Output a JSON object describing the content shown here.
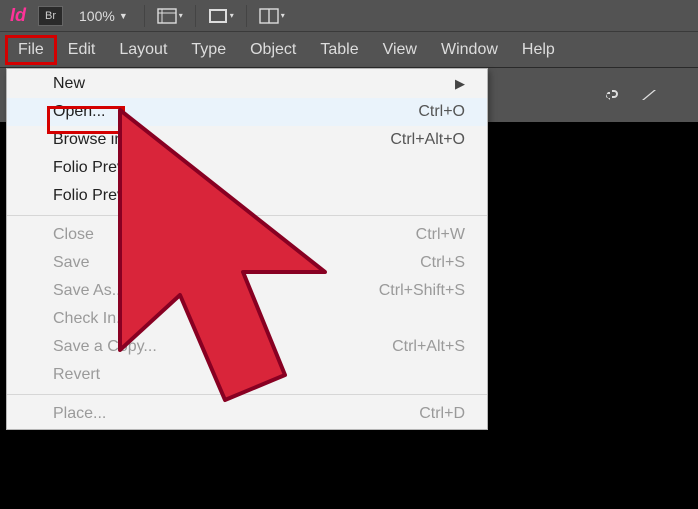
{
  "app": {
    "logo": "Id",
    "bridge": "Br",
    "zoom": "100%"
  },
  "menubar": [
    "File",
    "Edit",
    "Layout",
    "Type",
    "Object",
    "Table",
    "View",
    "Window",
    "Help"
  ],
  "dropdown": {
    "group1": [
      {
        "label": "New",
        "shortcut": "",
        "submenu": true
      },
      {
        "label": "Open...",
        "shortcut": "Ctrl+O",
        "hover": true
      },
      {
        "label": "Browse in",
        "shortcut": "Ctrl+Alt+O"
      },
      {
        "label": "Folio Previ",
        "shortcut": ""
      },
      {
        "label": "Folio Preview S",
        "shortcut": ""
      }
    ],
    "group2": [
      {
        "label": "Close",
        "shortcut": "Ctrl+W",
        "disabled": true
      },
      {
        "label": "Save",
        "shortcut": "Ctrl+S",
        "disabled": true
      },
      {
        "label": "Save As...",
        "shortcut": "Ctrl+Shift+S",
        "disabled": true
      },
      {
        "label": "Check In...",
        "shortcut": "",
        "disabled": true
      },
      {
        "label": "Save a Copy...",
        "shortcut": "Ctrl+Alt+S",
        "disabled": true
      },
      {
        "label": "Revert",
        "shortcut": "",
        "disabled": true
      }
    ],
    "group3": [
      {
        "label": "Place...",
        "shortcut": "Ctrl+D",
        "disabled": true
      }
    ]
  },
  "highlight": {
    "menu": "File",
    "item": "Open..."
  },
  "cursor_color": "#d9253a"
}
